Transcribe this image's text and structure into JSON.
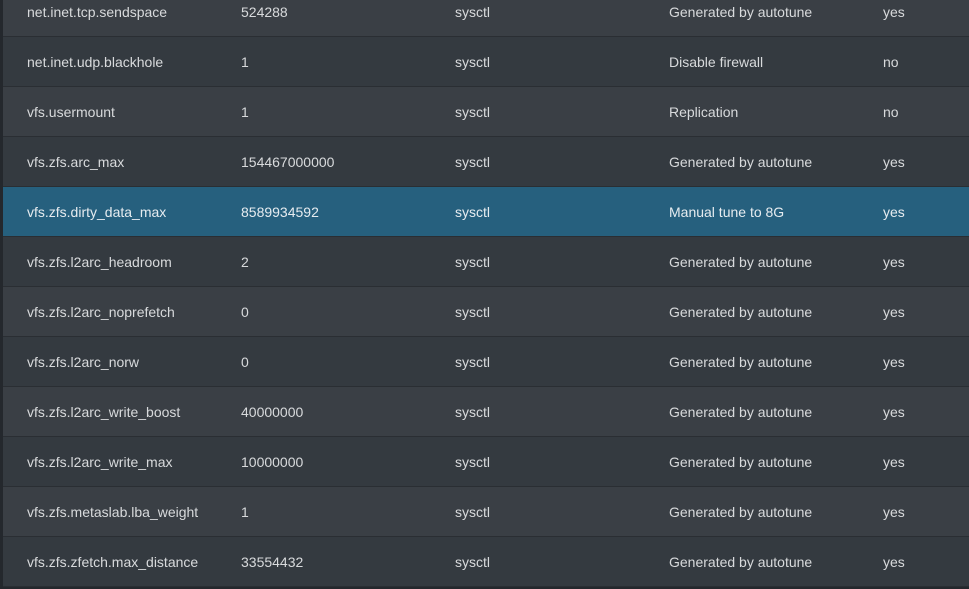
{
  "colors": {
    "row_odd": "#3a3f45",
    "row_even": "#343a40",
    "row_selected": "#26607e",
    "text": "#d8dadc"
  },
  "tunables": {
    "rows": [
      {
        "variable": "net.inet.tcp.sendspace",
        "value": "524288",
        "type": "sysctl",
        "comment": "Generated by autotune",
        "enabled": "yes",
        "selected": false
      },
      {
        "variable": "net.inet.udp.blackhole",
        "value": "1",
        "type": "sysctl",
        "comment": "Disable firewall",
        "enabled": "no",
        "selected": false
      },
      {
        "variable": "vfs.usermount",
        "value": "1",
        "type": "sysctl",
        "comment": "Replication",
        "enabled": "no",
        "selected": false
      },
      {
        "variable": "vfs.zfs.arc_max",
        "value": "154467000000",
        "type": "sysctl",
        "comment": "Generated by autotune",
        "enabled": "yes",
        "selected": false
      },
      {
        "variable": "vfs.zfs.dirty_data_max",
        "value": "8589934592",
        "type": "sysctl",
        "comment": "Manual tune to 8G",
        "enabled": "yes",
        "selected": true
      },
      {
        "variable": "vfs.zfs.l2arc_headroom",
        "value": "2",
        "type": "sysctl",
        "comment": "Generated by autotune",
        "enabled": "yes",
        "selected": false
      },
      {
        "variable": "vfs.zfs.l2arc_noprefetch",
        "value": "0",
        "type": "sysctl",
        "comment": "Generated by autotune",
        "enabled": "yes",
        "selected": false
      },
      {
        "variable": "vfs.zfs.l2arc_norw",
        "value": "0",
        "type": "sysctl",
        "comment": "Generated by autotune",
        "enabled": "yes",
        "selected": false
      },
      {
        "variable": "vfs.zfs.l2arc_write_boost",
        "value": "40000000",
        "type": "sysctl",
        "comment": "Generated by autotune",
        "enabled": "yes",
        "selected": false
      },
      {
        "variable": "vfs.zfs.l2arc_write_max",
        "value": "10000000",
        "type": "sysctl",
        "comment": "Generated by autotune",
        "enabled": "yes",
        "selected": false
      },
      {
        "variable": "vfs.zfs.metaslab.lba_weight",
        "value": "1",
        "type": "sysctl",
        "comment": "Generated by autotune",
        "enabled": "yes",
        "selected": false
      },
      {
        "variable": "vfs.zfs.zfetch.max_distance",
        "value": "33554432",
        "type": "sysctl",
        "comment": "Generated by autotune",
        "enabled": "yes",
        "selected": false
      }
    ]
  }
}
